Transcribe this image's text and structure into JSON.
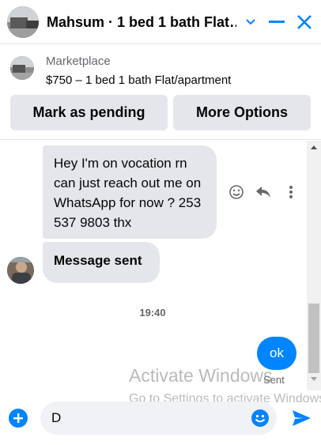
{
  "header": {
    "title": "Mahsum · 1 bed 1 bath Flat…"
  },
  "marketplace": {
    "label": "Marketplace",
    "listing": "$750 – 1 bed 1 bath Flat/apartment",
    "buttons": {
      "pending": "Mark as pending",
      "more": "More Options"
    }
  },
  "messages": {
    "incoming_1": "Hey I'm on vocation rn can just reach out me on WhatsApp for now ? 253 537 9803 thx",
    "incoming_2": "Message sent",
    "timestamp": "19:40",
    "outgoing": "ok",
    "status": "Sent"
  },
  "watermark": {
    "line1": "Activate Windows",
    "line2": "Go to Settings to activate Windows."
  },
  "composer": {
    "value": "D"
  },
  "icons": {
    "header": [
      "avatar",
      "chevron-down-icon",
      "minimize-icon",
      "close-icon"
    ],
    "actions": [
      "react-icon",
      "reply-icon",
      "more-icon"
    ],
    "composer": [
      "plus-icon",
      "emoji-icon",
      "send-icon"
    ]
  },
  "colors": {
    "accent": "#0084ff",
    "bubble_in": "#e4e6eb",
    "button_bg": "#e4e6eb",
    "input_bg": "#f0f2f5"
  }
}
